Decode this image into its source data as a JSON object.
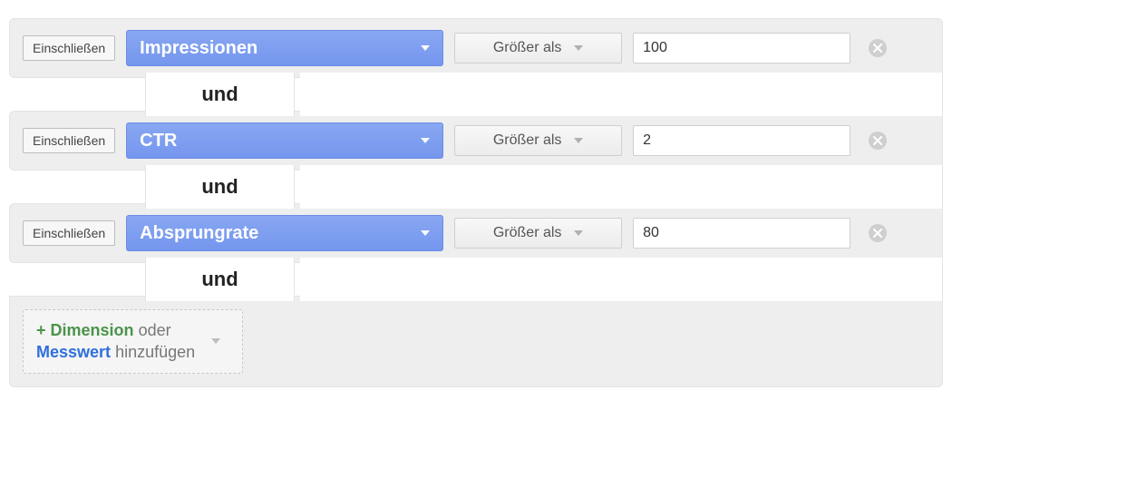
{
  "labels": {
    "include": "Einschließen",
    "and": "und",
    "add_prefix": "+",
    "add_dimension": "Dimension",
    "add_or": "oder",
    "add_metric": "Messwert",
    "add_suffix": "hinzufügen"
  },
  "rules": [
    {
      "metric": "Impressionen",
      "operator": "Größer als",
      "value": "100"
    },
    {
      "metric": "CTR",
      "operator": "Größer als",
      "value": "2"
    },
    {
      "metric": "Absprungrate",
      "operator": "Größer als",
      "value": "80"
    }
  ]
}
